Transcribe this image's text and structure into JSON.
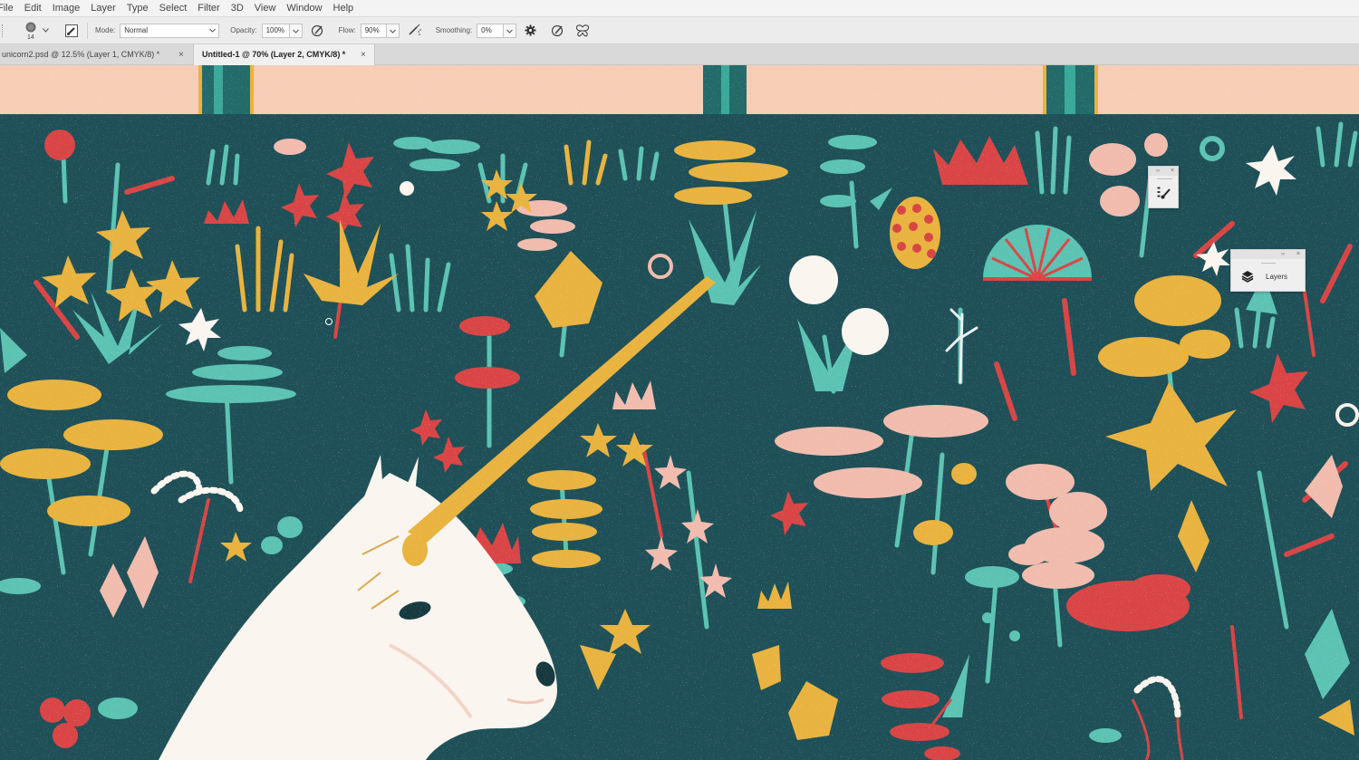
{
  "menu": {
    "items": [
      "File",
      "Edit",
      "Image",
      "Layer",
      "Type",
      "Select",
      "Filter",
      "3D",
      "View",
      "Window",
      "Help"
    ]
  },
  "options": {
    "brush_size": "14",
    "mode_label": "Mode:",
    "mode_value": "Normal",
    "opacity_label": "Opacity:",
    "opacity_value": "100%",
    "flow_label": "Flow:",
    "flow_value": "90%",
    "smoothing_label": "Smoothing:",
    "smoothing_value": "0%"
  },
  "tabs": [
    {
      "label": "unicorn2.psd @ 12.5% (Layer 1, CMYK/8) *",
      "close": "×",
      "active": false
    },
    {
      "label": "Untitled-1 @ 70% (Layer 2, CMYK/8) *",
      "close": "×",
      "active": true
    }
  ],
  "panels": {
    "mini": {
      "arrows": "››",
      "close": "×",
      "icon": "brush-settings-icon"
    },
    "layers": {
      "arrows": "››",
      "close": "×",
      "label": "Layers",
      "icon": "layers-icon"
    }
  },
  "colors": {
    "canvas_bg": "#1f5058",
    "peach": "#f7cdb5",
    "teal": "#5cc3b3",
    "red": "#d94545",
    "mustard": "#e9b33f",
    "pink": "#f1bcae",
    "white": "#fbf5ef"
  }
}
